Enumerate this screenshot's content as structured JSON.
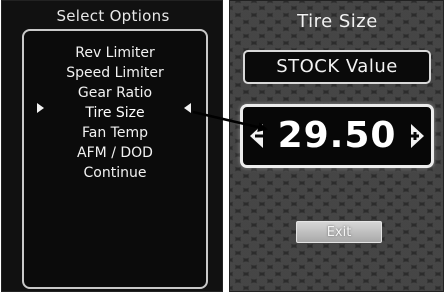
{
  "left_screen": {
    "title": "Select Options",
    "menu_items": [
      {
        "label": "Rev Limiter"
      },
      {
        "label": "Speed Limiter"
      },
      {
        "label": "Gear Ratio"
      },
      {
        "label": "Tire Size"
      },
      {
        "label": "Fan Temp"
      },
      {
        "label": "AFM / DOD"
      },
      {
        "label": "Continue"
      }
    ],
    "selected_index": 3
  },
  "right_screen": {
    "title": "Tire Size",
    "stock_label": "STOCK Value",
    "value": "29.50",
    "exit_label": "Exit"
  },
  "icons": {
    "selection_arrows": "triangle-pointers",
    "decrement": "left-arrow-minus-icon",
    "increment": "right-arrow-plus-icon",
    "callout": "arrow-icon"
  },
  "colors": {
    "screen_background": "#111111",
    "text": "#f2f2f2",
    "panel_border": "#c9c9c9",
    "exit_button": "#c4c4c4"
  }
}
